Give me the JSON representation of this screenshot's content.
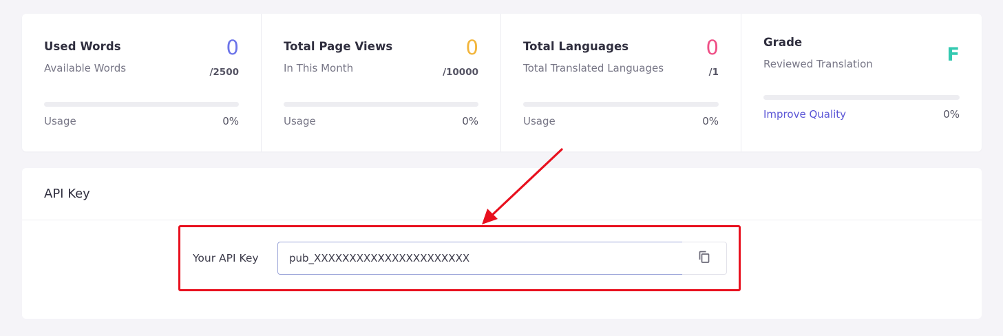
{
  "stats": [
    {
      "title": "Used Words",
      "subtitle": "Available Words",
      "value": "0",
      "limit": "/2500",
      "label": "Usage",
      "percent": "0%",
      "usage_fraction": 0,
      "value_color": "#6c74e9"
    },
    {
      "title": "Total Page Views",
      "subtitle": "In This Month",
      "value": "0",
      "limit": "/10000",
      "label": "Usage",
      "percent": "0%",
      "usage_fraction": 0,
      "value_color": "#f2b53b"
    },
    {
      "title": "Total Languages",
      "subtitle": "Total Translated Languages",
      "value": "0",
      "limit": "/1",
      "label": "Usage",
      "percent": "0%",
      "usage_fraction": 0,
      "value_color": "#ef4f86"
    },
    {
      "title": "Grade",
      "subtitle": "Reviewed Translation",
      "value": "F",
      "link_label": "Improve Quality",
      "percent": "0%",
      "usage_fraction": 0,
      "value_color": "#33c9b0"
    }
  ],
  "api": {
    "title": "API Key",
    "row_label": "Your API Key",
    "key_value": "pub_XXXXXXXXXXXXXXXXXXXXXX",
    "copy_icon": "copy-icon"
  },
  "annotation": {
    "color": "#e8101e"
  }
}
